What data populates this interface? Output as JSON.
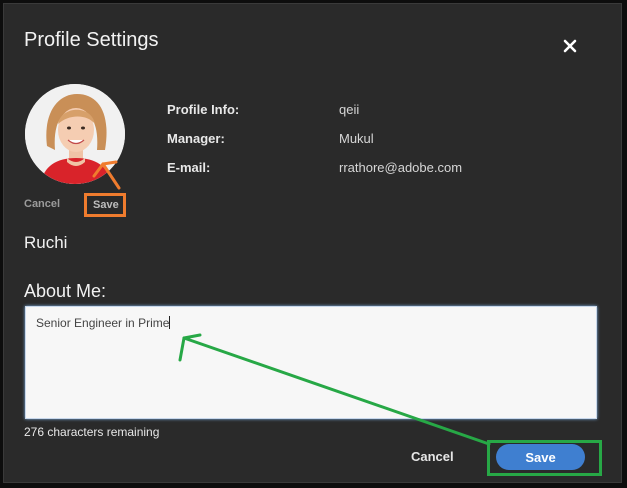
{
  "dialog": {
    "title": "Profile Settings",
    "close_icon": "close-icon"
  },
  "photo": {
    "cancel_label": "Cancel",
    "save_label": "Save"
  },
  "profile_info": [
    {
      "label": "Profile Info:",
      "value": "qeii"
    },
    {
      "label": "Manager:",
      "value": "Mukul"
    },
    {
      "label": "E-mail:",
      "value": "rrathore@adobe.com"
    }
  ],
  "user": {
    "name": "Ruchi"
  },
  "about": {
    "label": "About Me:",
    "value": "Senior Engineer in Prime",
    "remaining": "276 characters remaining"
  },
  "footer": {
    "cancel_label": "Cancel",
    "save_label": "Save"
  },
  "colors": {
    "accent_orange": "#f07c2e",
    "accent_green": "#27a846",
    "save_blue": "#3f7fd0"
  }
}
